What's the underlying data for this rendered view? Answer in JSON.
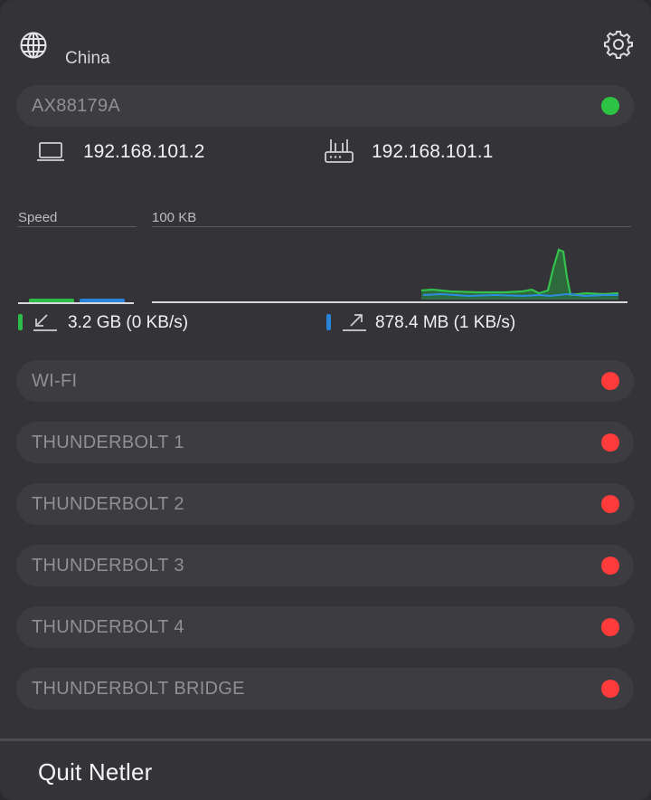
{
  "header": {
    "region": "China",
    "globe_icon": "globe-icon",
    "settings_icon": "gear-icon"
  },
  "active_interface": {
    "name": "AX88179A",
    "status_color": "#2dc444",
    "local_ip": "192.168.101.2",
    "router_ip": "192.168.101.1",
    "local_icon": "laptop-icon",
    "router_icon": "router-icon"
  },
  "traffic": {
    "speed_label": "Speed",
    "scale_label": "100 KB",
    "download": {
      "text": "3.2 GB (0 KB/s)",
      "color": "#2dbb4a",
      "icon": "arrow-down-left-icon"
    },
    "upload": {
      "text": "878.4 MB (1 KB/s)",
      "color": "#2a84d8",
      "icon": "arrow-up-right-icon"
    }
  },
  "interfaces": [
    {
      "name": "WI-FI",
      "status_color": "#ff3b3b"
    },
    {
      "name": "THUNDERBOLT 1",
      "status_color": "#ff3b3b"
    },
    {
      "name": "THUNDERBOLT 2",
      "status_color": "#ff3b3b"
    },
    {
      "name": "THUNDERBOLT 3",
      "status_color": "#ff3b3b"
    },
    {
      "name": "THUNDERBOLT 4",
      "status_color": "#ff3b3b"
    },
    {
      "name": "THUNDERBOLT BRIDGE",
      "status_color": "#ff3b3b"
    }
  ],
  "footer": {
    "quit_label": "Quit Netler"
  }
}
